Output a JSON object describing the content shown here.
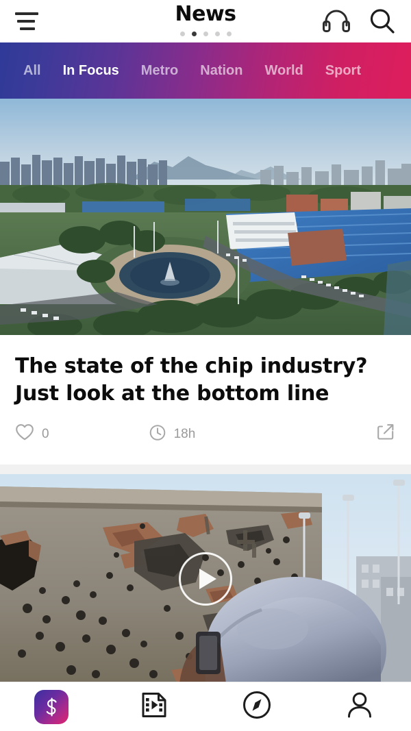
{
  "header": {
    "title": "News",
    "menu_icon": "hamburger-menu-icon",
    "audio_icon": "headphones-icon",
    "search_icon": "search-icon",
    "pager": {
      "count": 5,
      "active_index": 1
    }
  },
  "tabs": {
    "items": [
      {
        "label": "All",
        "active": false
      },
      {
        "label": "In Focus",
        "active": true
      },
      {
        "label": "Metro",
        "active": false
      },
      {
        "label": "Nation",
        "active": false
      },
      {
        "label": "World",
        "active": false
      },
      {
        "label": "Sport",
        "active": false
      }
    ],
    "gradient_start": "#2f3a98",
    "gradient_end": "#de1e5c"
  },
  "feed": {
    "articles": [
      {
        "type": "article",
        "headline": "The state of the chip industry? Just look at the bottom line",
        "image_alt": "Aerial view of an industrial park with blue-roofed factories, a circular fountain plaza and city skyline",
        "like_icon": "heart-icon",
        "like_count": "0",
        "time_icon": "clock-icon",
        "time_ago": "18h",
        "share_icon": "share-icon"
      },
      {
        "type": "video",
        "image_alt": "Bullet-riddled concrete wall with a person wearing a light cap in the foreground",
        "play_icon": "play-icon"
      }
    ]
  },
  "bottom_nav": {
    "items": [
      {
        "name": "home-logo",
        "icon": "app-logo-s-icon",
        "label": ""
      },
      {
        "name": "video",
        "icon": "video-file-icon",
        "label": ""
      },
      {
        "name": "discover",
        "icon": "compass-icon",
        "label": ""
      },
      {
        "name": "profile",
        "icon": "person-icon",
        "label": ""
      }
    ]
  },
  "colors": {
    "text_primary": "#0c0c0c",
    "text_muted": "#9a9a9a",
    "accent_blue": "#2f3a98",
    "accent_pink": "#de1e5c",
    "divider": "#f1f1f1"
  }
}
